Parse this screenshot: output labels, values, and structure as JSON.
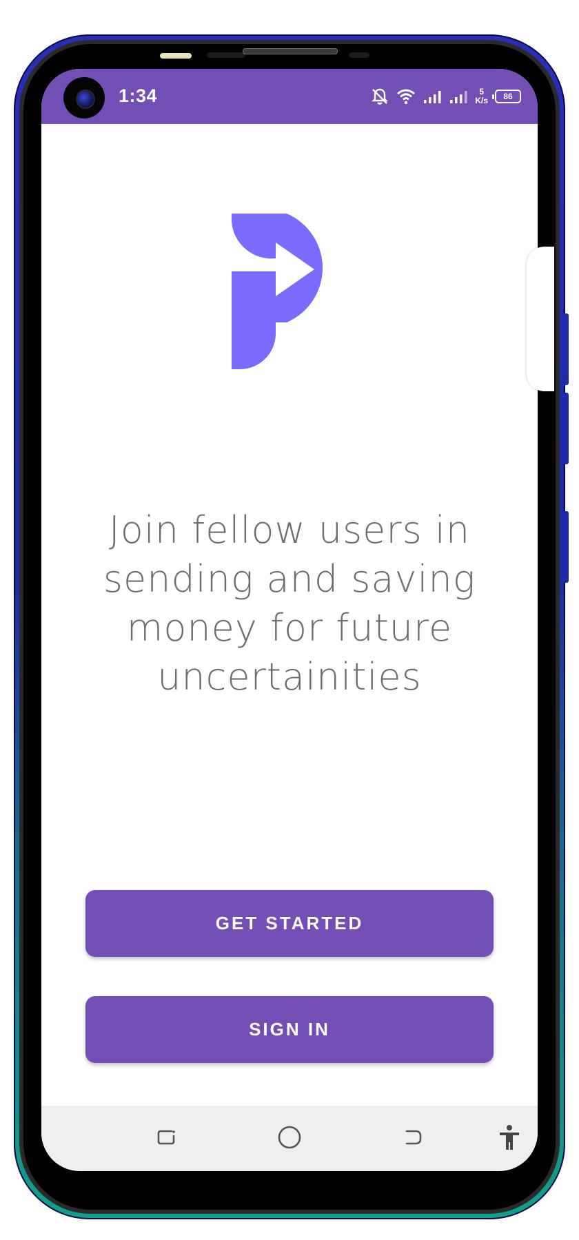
{
  "status_bar": {
    "time": "1:34",
    "net_speed_value": "5",
    "net_speed_unit": "K/s",
    "battery_level": "86",
    "icons": [
      "camera-icon",
      "mute-bell-icon",
      "wifi-icon",
      "signal-icon",
      "signal-icon",
      "battery-icon"
    ]
  },
  "app": {
    "logo_icon": "arrow-p-logo",
    "brand_color": "#734fb5",
    "logo_color": "#7a6bff",
    "tagline_lines": [
      "Join fellow users in",
      "sending and saving",
      "money for future",
      "uncertainities"
    ],
    "get_started_label": "GET STARTED",
    "sign_in_label": "SIGN IN"
  },
  "nav_bar": {
    "icons": [
      "recent-apps-icon",
      "home-icon",
      "back-icon",
      "accessibility-icon"
    ]
  }
}
